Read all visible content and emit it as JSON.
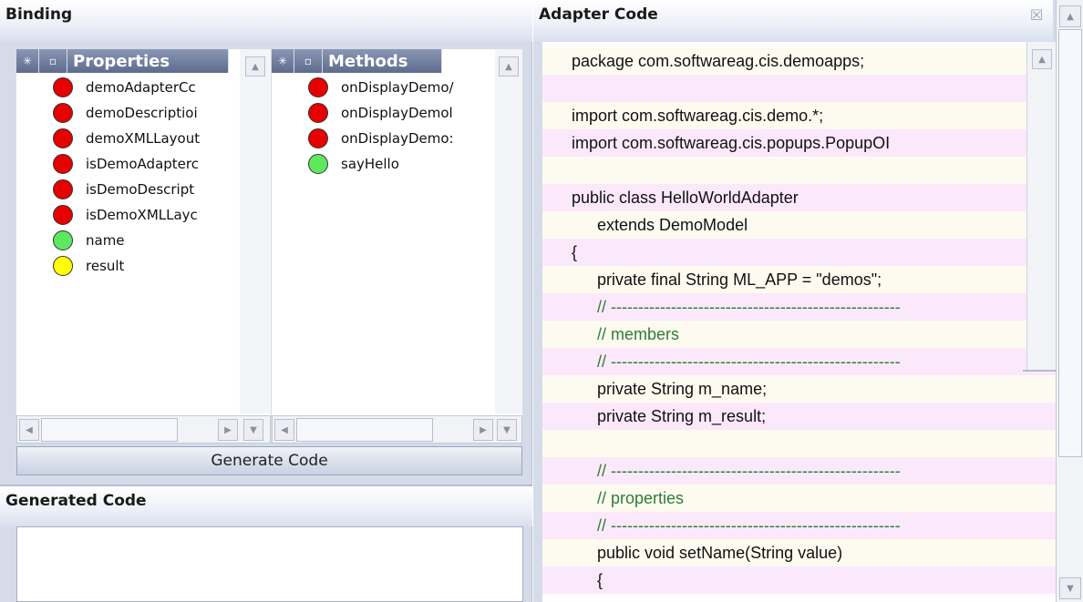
{
  "binding": {
    "title": "Binding",
    "properties": {
      "header": "Properties",
      "items": [
        {
          "label": "demoAdapterCc",
          "status": "red"
        },
        {
          "label": "demoDescriptioi",
          "status": "red"
        },
        {
          "label": "demoXMLLayout",
          "status": "red"
        },
        {
          "label": "isDemoAdapterc",
          "status": "red"
        },
        {
          "label": "isDemoDescript",
          "status": "red"
        },
        {
          "label": "isDemoXMLLayc",
          "status": "red"
        },
        {
          "label": "name",
          "status": "green"
        },
        {
          "label": "result",
          "status": "yellow"
        }
      ]
    },
    "methods": {
      "header": "Methods",
      "items": [
        {
          "label": "onDisplayDemo/",
          "status": "red"
        },
        {
          "label": "onDisplayDemol",
          "status": "red"
        },
        {
          "label": "onDisplayDemo:",
          "status": "red"
        },
        {
          "label": "sayHello",
          "status": "green"
        }
      ]
    },
    "generate_label": "Generate Code"
  },
  "generated": {
    "title": "Generated Code",
    "content": ""
  },
  "adapter": {
    "title": "Adapter Code",
    "close_glyph": "☒",
    "lines": [
      {
        "text": "package com.softwareag.cis.demoapps;",
        "indent": 0,
        "comment": false
      },
      {
        "text": "",
        "indent": 0,
        "comment": false
      },
      {
        "text": "import com.softwareag.cis.demo.*;",
        "indent": 0,
        "comment": false
      },
      {
        "text": "import com.softwareag.cis.popups.PopupOI",
        "indent": 0,
        "comment": false
      },
      {
        "text": "",
        "indent": 0,
        "comment": false
      },
      {
        "text": "public class HelloWorldAdapter",
        "indent": 0,
        "comment": false
      },
      {
        "text": "extends DemoModel",
        "indent": 1,
        "comment": false
      },
      {
        "text": "{",
        "indent": 0,
        "comment": false
      },
      {
        "text": "private final String ML_APP = \"demos\";",
        "indent": 1,
        "comment": false
      },
      {
        "text": "// -----------------------------------------------------",
        "indent": 1,
        "comment": true
      },
      {
        "text": "// members",
        "indent": 1,
        "comment": true
      },
      {
        "text": "// -----------------------------------------------------",
        "indent": 1,
        "comment": true
      },
      {
        "text": "private String m_name;",
        "indent": 1,
        "comment": false
      },
      {
        "text": "private String m_result;",
        "indent": 1,
        "comment": false
      },
      {
        "text": "",
        "indent": 0,
        "comment": false
      },
      {
        "text": "// -----------------------------------------------------",
        "indent": 1,
        "comment": true
      },
      {
        "text": "// properties",
        "indent": 1,
        "comment": true
      },
      {
        "text": "// -----------------------------------------------------",
        "indent": 1,
        "comment": true
      },
      {
        "text": "public void setName(String value)",
        "indent": 1,
        "comment": false
      },
      {
        "text": "{",
        "indent": 1,
        "comment": false
      }
    ]
  },
  "colors": {
    "red": "#e60000",
    "green": "#5ee85e",
    "yellow": "#ffff00",
    "header_blue": "#6b7899",
    "comment": "#2e7d32",
    "row_alt": "#fbe9fb",
    "row_base": "#fdfbf0"
  },
  "icons": {
    "expand_all": "asterisk-icon",
    "collapse_all": "square-icon",
    "close": "close-icon"
  }
}
